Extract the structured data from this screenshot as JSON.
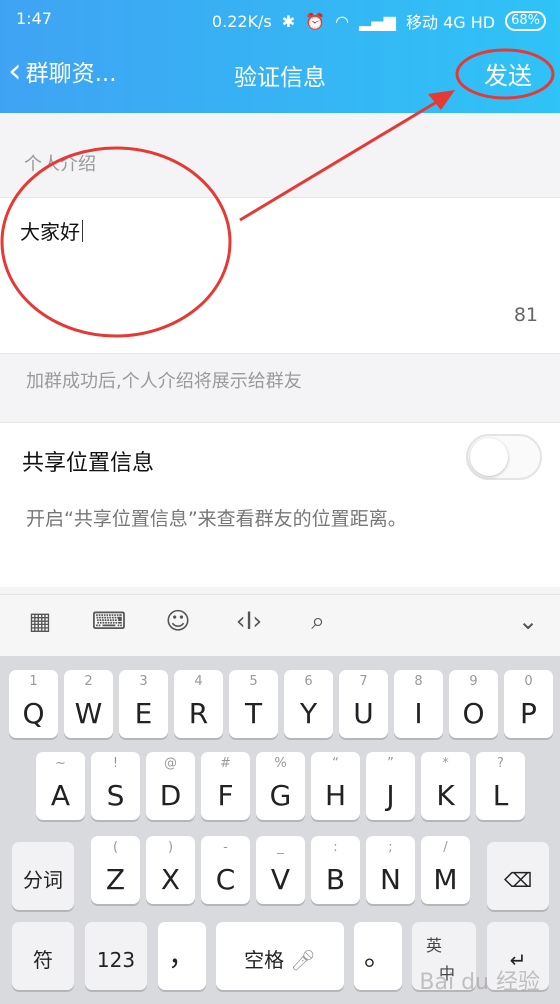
{
  "status": {
    "time": "1:47",
    "speed": "0.22K/s",
    "carrier": "移动 4G HD",
    "battery": "68%"
  },
  "nav": {
    "back_label": "群聊资...",
    "title": "验证信息",
    "send_label": "发送"
  },
  "intro": {
    "label": "个人介绍",
    "value": "大家好",
    "remaining": "81"
  },
  "hint1": "加群成功后,个人介绍将展示给群友",
  "share": {
    "label": "共享位置信息",
    "enabled": false
  },
  "hint2": "开启“共享位置信息”来查看群友的位置距离。",
  "keyboard": {
    "row1": [
      {
        "k": "Q",
        "s": "1"
      },
      {
        "k": "W",
        "s": "2"
      },
      {
        "k": "E",
        "s": "3"
      },
      {
        "k": "R",
        "s": "4"
      },
      {
        "k": "T",
        "s": "5"
      },
      {
        "k": "Y",
        "s": "6"
      },
      {
        "k": "U",
        "s": "7"
      },
      {
        "k": "I",
        "s": "8"
      },
      {
        "k": "O",
        "s": "9"
      },
      {
        "k": "P",
        "s": "0"
      }
    ],
    "row2": [
      {
        "k": "A",
        "s": "~"
      },
      {
        "k": "S",
        "s": "!"
      },
      {
        "k": "D",
        "s": "@"
      },
      {
        "k": "F",
        "s": "#"
      },
      {
        "k": "G",
        "s": "%"
      },
      {
        "k": "H",
        "s": "“"
      },
      {
        "k": "J",
        "s": "”"
      },
      {
        "k": "K",
        "s": "*"
      },
      {
        "k": "L",
        "s": "?"
      }
    ],
    "row3": [
      {
        "k": "Z",
        "s": "("
      },
      {
        "k": "X",
        "s": ")"
      },
      {
        "k": "C",
        "s": "-"
      },
      {
        "k": "V",
        "s": "_"
      },
      {
        "k": "B",
        "s": ":"
      },
      {
        "k": "N",
        "s": ";"
      },
      {
        "k": "M",
        "s": "/"
      }
    ],
    "fenci": "分词",
    "fu": "符",
    "num": "123",
    "comma": "，",
    "space": "空格",
    "period": "。",
    "lang_top": "英",
    "lang_bottom": "中"
  },
  "watermark": "Bai du 经验"
}
